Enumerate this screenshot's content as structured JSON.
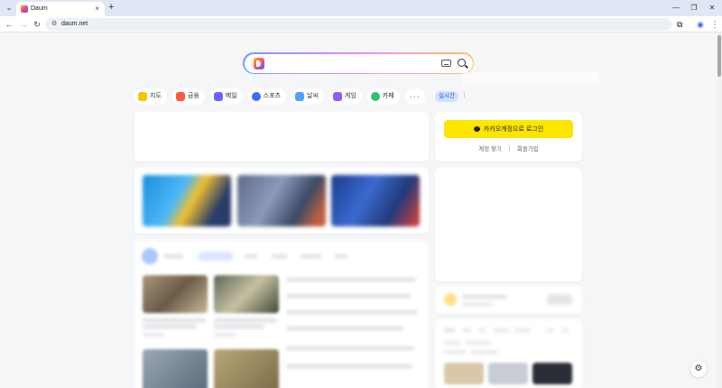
{
  "browser": {
    "tab_title": "Daum",
    "tab_close": "×",
    "new_tab": "+",
    "tab_menu": "⌄",
    "url": "daum.net",
    "nav": {
      "back": "←",
      "forward": "→",
      "reload": "↻"
    },
    "window": {
      "minimize": "—",
      "restore": "❐",
      "close": "✕"
    }
  },
  "services": [
    {
      "label": "지도",
      "icon": "map-icon",
      "color": "#f2c500"
    },
    {
      "label": "금융",
      "icon": "finance-icon",
      "color": "#ff5a3c"
    },
    {
      "label": "메일",
      "icon": "mail-icon",
      "color": "#6c63ff"
    },
    {
      "label": "스포츠",
      "icon": "sports-icon",
      "color": "#3a6cff"
    },
    {
      "label": "날씨",
      "icon": "weather-icon",
      "color": "#4aa3ff"
    },
    {
      "label": "게임",
      "icon": "game-icon",
      "color": "#8d5cff"
    },
    {
      "label": "카페",
      "icon": "cafe-icon",
      "color": "#2fbf71"
    }
  ],
  "more_label": "···",
  "realtime_label": "실시간",
  "login": {
    "button": "카카오계정으로 로그인",
    "find_account": "계정 찾기",
    "signup": "회원가입"
  },
  "colors": {
    "kakao_yellow": "#fee500",
    "page_bg": "#f5f6f8"
  }
}
